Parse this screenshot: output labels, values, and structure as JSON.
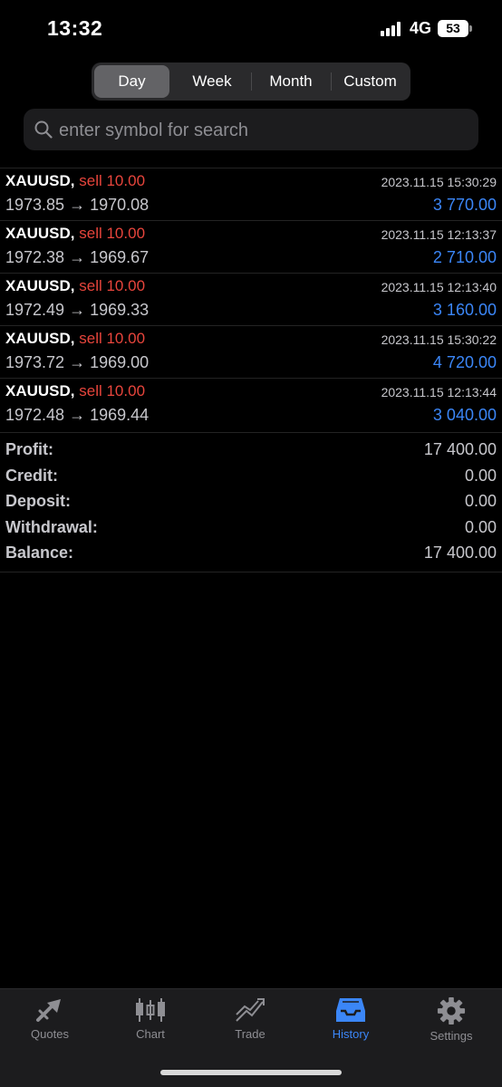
{
  "status": {
    "time": "13:32",
    "network": "4G",
    "battery": "53"
  },
  "periods": [
    {
      "label": "Day",
      "active": true
    },
    {
      "label": "Week",
      "active": false
    },
    {
      "label": "Month",
      "active": false
    },
    {
      "label": "Custom",
      "active": false
    }
  ],
  "search": {
    "placeholder": "enter symbol for search",
    "icon": "search-icon"
  },
  "deals": [
    {
      "symbol": "XAUUSD,",
      "side": "sell 10.00",
      "open": "1973.85",
      "close": "1970.08",
      "time": "2023.11.15 15:30:29",
      "profit": "3 770.00"
    },
    {
      "symbol": "XAUUSD,",
      "side": "sell 10.00",
      "open": "1972.38",
      "close": "1969.67",
      "time": "2023.11.15 12:13:37",
      "profit": "2 710.00"
    },
    {
      "symbol": "XAUUSD,",
      "side": "sell 10.00",
      "open": "1972.49",
      "close": "1969.33",
      "time": "2023.11.15 12:13:40",
      "profit": "3 160.00"
    },
    {
      "symbol": "XAUUSD,",
      "side": "sell 10.00",
      "open": "1973.72",
      "close": "1969.00",
      "time": "2023.11.15 15:30:22",
      "profit": "4 720.00"
    },
    {
      "symbol": "XAUUSD,",
      "side": "sell 10.00",
      "open": "1972.48",
      "close": "1969.44",
      "time": "2023.11.15 12:13:44",
      "profit": "3 040.00"
    }
  ],
  "arrow": "→",
  "summary": [
    {
      "label": "Profit:",
      "value": "17 400.00"
    },
    {
      "label": "Credit:",
      "value": "0.00"
    },
    {
      "label": "Deposit:",
      "value": "0.00"
    },
    {
      "label": "Withdrawal:",
      "value": "0.00"
    },
    {
      "label": "Balance:",
      "value": "17 400.00"
    }
  ],
  "tabs": [
    {
      "label": "Quotes",
      "icon": "quotes-icon",
      "active": false
    },
    {
      "label": "Chart",
      "icon": "candlestick-chart-icon",
      "active": false
    },
    {
      "label": "Trade",
      "icon": "trade-trend-icon",
      "active": false
    },
    {
      "label": "History",
      "icon": "history-inbox-icon",
      "active": true
    },
    {
      "label": "Settings",
      "icon": "gear-icon",
      "active": false
    }
  ],
  "colors": {
    "sell": "#e8453c",
    "profit": "#3b86f7",
    "activeTab": "#3b86f7",
    "inactiveTab": "#8e8e93"
  }
}
